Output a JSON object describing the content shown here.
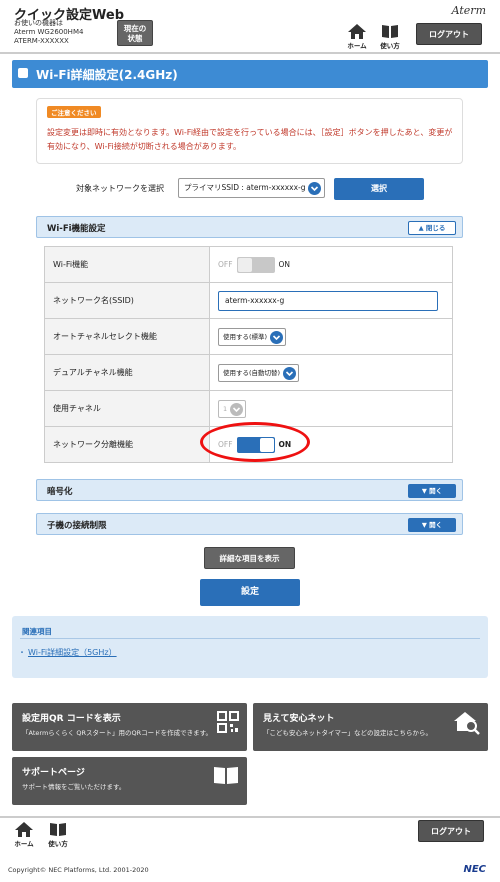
{
  "header": {
    "app_title": "クイック設定Web",
    "device_line1": "お使いの機器は",
    "device_line2": "Aterm WG2600HM4",
    "device_line3": "ATERM-XXXXXX",
    "status_label_1": "現在の",
    "status_label_2": "状態",
    "brand": "Aterm",
    "home_label": "ホーム",
    "howto_label": "使い方",
    "logout_label": "ログアウト"
  },
  "page": {
    "title": "Wi-Fi詳細設定(2.4GHz)"
  },
  "notice": {
    "badge": "ご注意ください",
    "text": "設定変更は即時に有効となります。Wi-Fi経由で設定を行っている場合には、［設定］ボタンを押したあと、変更が有効になり、Wi-Fi接続が切断される場合があります。"
  },
  "network_select": {
    "label": "対象ネットワークを選択",
    "value": "プライマリSSID : aterm-xxxxxx-g",
    "button": "選択"
  },
  "wifi_section": {
    "title": "Wi-Fi機能設定",
    "toggle_label": "閉じる",
    "rows": {
      "wifi_function": {
        "label": "Wi-Fi機能",
        "off": "OFF",
        "on": "ON",
        "state": "off"
      },
      "ssid": {
        "label": "ネットワーク名(SSID)",
        "value": "aterm-xxxxxx-g"
      },
      "auto_channel": {
        "label": "オートチャネルセレクト機能",
        "value": "使用する(標準)"
      },
      "dual_channel": {
        "label": "デュアルチャネル機能",
        "value": "使用する(自動切替)"
      },
      "channel": {
        "label": "使用チャネル",
        "value": "1"
      },
      "network_separation": {
        "label": "ネットワーク分離機能",
        "off": "OFF",
        "on": "ON",
        "state": "on"
      }
    }
  },
  "encryption_section": {
    "title": "暗号化",
    "toggle_label": "開く"
  },
  "restriction_section": {
    "title": "子機の接続制限",
    "toggle_label": "開く"
  },
  "buttons": {
    "show_details": "詳細な項目を表示",
    "apply": "設定"
  },
  "related": {
    "title": "関連項目",
    "link": "Wi-Fi詳細設定（5GHz）"
  },
  "tiles": {
    "qr": {
      "title": "設定用QR コードを表示",
      "desc": "「Atermらくらく QRスタート」用のQRコードを作成できます。"
    },
    "safety": {
      "title": "見えて安心ネット",
      "desc": "「こども安心ネットタイマー」などの設定はこちらから。"
    },
    "support": {
      "title": "サポートページ",
      "desc": "サポート情報をご覧いただけます。"
    }
  },
  "footer": {
    "home_label": "ホーム",
    "howto_label": "使い方",
    "logout_label": "ログアウト",
    "copyright": "Copyright© NEC Platforms, Ltd. 2001-2020",
    "brand": "NEC"
  },
  "colors": {
    "accent": "#2a6fb8",
    "title_bar": "#3d8bd4",
    "notice_text": "#c0392b",
    "highlight_oval": "#e11111"
  }
}
